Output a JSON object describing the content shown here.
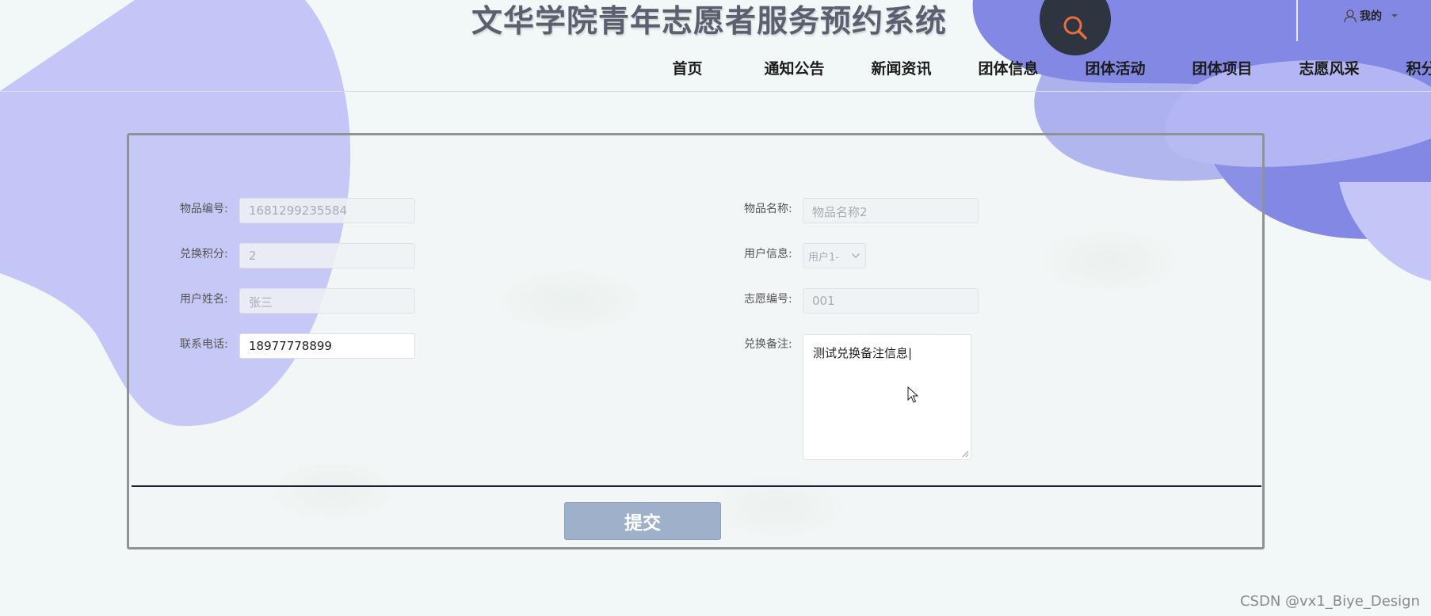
{
  "app": {
    "title": "文华学院青年志愿者服务预约系统"
  },
  "header": {
    "user_label": "我的",
    "nav": [
      "首页",
      "通知公告",
      "新闻资讯",
      "团体信息",
      "团体活动",
      "团体项目",
      "志愿风采",
      "积分兑换"
    ]
  },
  "form": {
    "item_no": {
      "label": "物品编号:",
      "value": "1681299235584"
    },
    "item_name": {
      "label": "物品名称:",
      "value": "物品名称2"
    },
    "points": {
      "label": "兑换积分:",
      "value": "2"
    },
    "user_info": {
      "label": "用户信息:",
      "value": "用户1-"
    },
    "user_name": {
      "label": "用户姓名:",
      "value": "张三"
    },
    "volunteer_no": {
      "label": "志愿编号:",
      "value": "001"
    },
    "phone": {
      "label": "联系电话:",
      "value": "18977778899"
    },
    "remark": {
      "label": "兑换备注:",
      "value": "测试兑换备注信息|"
    },
    "submit_label": "提交"
  },
  "watermark": "CSDN @vx1_Biye_Design",
  "colors": {
    "blob_light": "#c3c6f7",
    "blob_dark": "#8288e4",
    "search_bg": "#2e3440",
    "search_icon": "#e8703a",
    "submit_bg": "#9fb0cb"
  },
  "icons": [
    "search-icon",
    "user-icon",
    "caret-down-icon",
    "chevron-down-icon",
    "mouse-cursor-icon"
  ]
}
